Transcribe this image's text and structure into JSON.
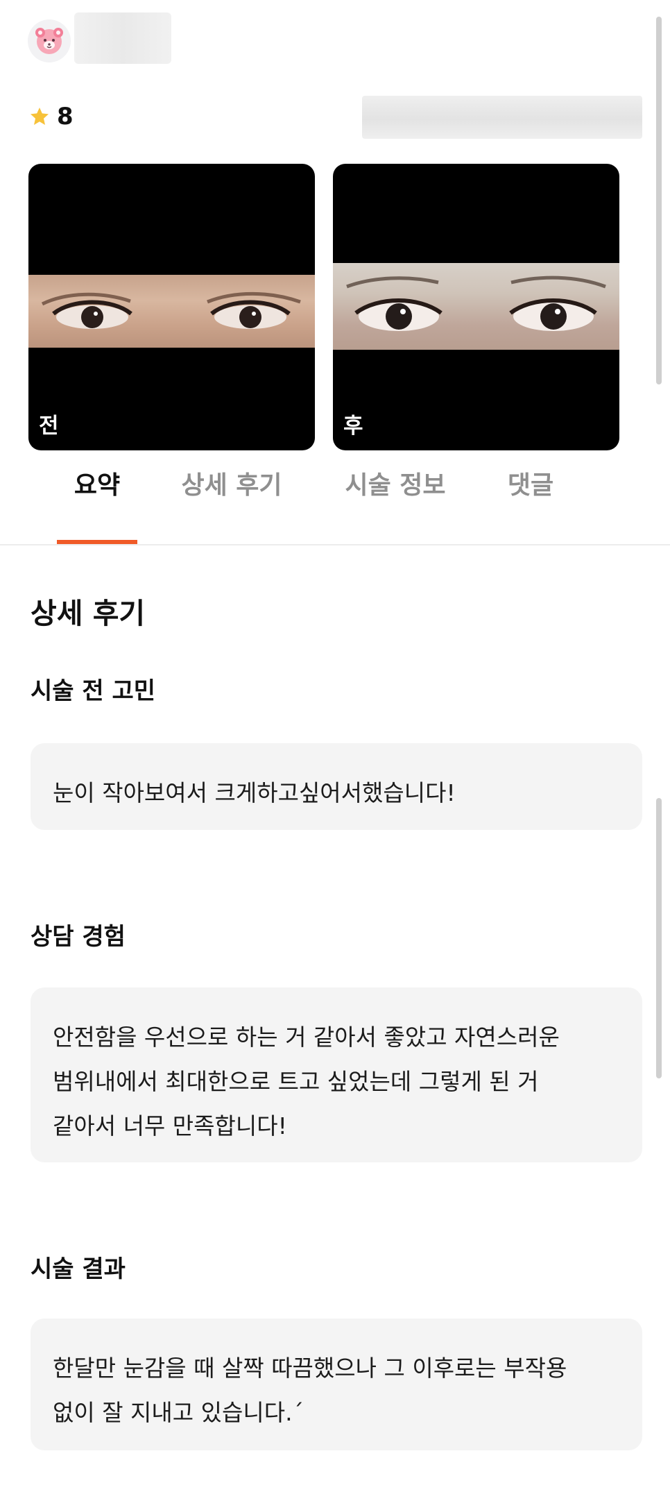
{
  "header": {
    "avatar_icon": "bear-avatar-icon",
    "rating": "8",
    "star_color": "#f7c23a"
  },
  "photos": [
    {
      "label": "전"
    },
    {
      "label": "후"
    }
  ],
  "tabs": [
    {
      "label": "요약",
      "active": true
    },
    {
      "label": "상세 후기",
      "active": false
    },
    {
      "label": "시술 정보",
      "active": false
    },
    {
      "label": "댓글",
      "active": false
    }
  ],
  "main": {
    "section_title": "상세 후기",
    "sections": [
      {
        "heading": "시술 전 고민",
        "lines": [
          "눈이 작아보여서 크게하고싶어서했습니다!"
        ]
      },
      {
        "heading": "상담 경험",
        "lines": [
          "안전함을 우선으로 하는 거 같아서 좋았고 자연스러운",
          "범위내에서 최대한으로 트고 싶었는데 그렇게 된 거",
          "같아서 너무 만족합니다!"
        ]
      },
      {
        "heading": "시술 결과",
        "lines": [
          "한달만 눈감을 때 살짝 따끔했으나 그 이후로는 부작용",
          "없이 잘 지내고 있습니다.ˊ"
        ]
      }
    ]
  },
  "accent_color": "#f05a28"
}
